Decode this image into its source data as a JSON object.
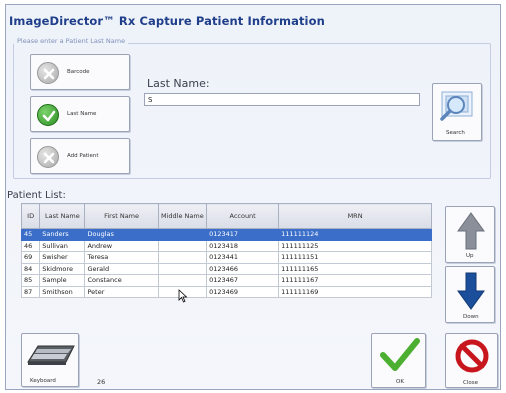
{
  "window": {
    "title": "ImageDirector™ Rx Capture Patient Information"
  },
  "search_group": {
    "legend": "Please enter a Patient Last Name",
    "buttons": {
      "barcode": "Barcode",
      "last_name": "Last Name",
      "add_patient": "Add Patient"
    },
    "last_name_label": "Last Name:",
    "last_name_value": "S",
    "search_label": "Search"
  },
  "patient_list": {
    "label": "Patient List:",
    "columns": [
      "ID",
      "Last Name",
      "First Name",
      "Middle Name",
      "Account",
      "MRN"
    ],
    "rows": [
      {
        "id": "45",
        "last": "Sanders",
        "first": "Douglas",
        "middle": "",
        "account": "0123417",
        "mrn": "111111124"
      },
      {
        "id": "46",
        "last": "Sullivan",
        "first": "Andrew",
        "middle": "",
        "account": "0123418",
        "mrn": "111111125"
      },
      {
        "id": "69",
        "last": "Swisher",
        "first": "Teresa",
        "middle": "",
        "account": "0123441",
        "mrn": "111111151"
      },
      {
        "id": "84",
        "last": "Skidmore",
        "first": "Gerald",
        "middle": "",
        "account": "0123466",
        "mrn": "111111165"
      },
      {
        "id": "85",
        "last": "Sample",
        "first": "Constance",
        "middle": "",
        "account": "0123467",
        "mrn": "111111167"
      },
      {
        "id": "87",
        "last": "Smithson",
        "first": "Peter",
        "middle": "",
        "account": "0123469",
        "mrn": "111111169"
      }
    ],
    "selected_index": 0
  },
  "side_buttons": {
    "up": "Up",
    "down": "Down"
  },
  "footer": {
    "keyboard": "Keyboard",
    "count": "26",
    "ok": "OK",
    "close": "Close"
  },
  "colors": {
    "title": "#1f3f8a",
    "selection": "#3a6ec9",
    "ok_green": "#4caf32",
    "close_red": "#c8161d",
    "arrow_blue": "#1b4f9c"
  },
  "icons": {
    "barcode": "grey-circle-x-icon",
    "last_name": "green-circle-check-icon",
    "add_patient": "grey-circle-x-icon",
    "search": "magnifier-search-icon",
    "up": "arrow-up-icon",
    "down": "arrow-down-icon",
    "keyboard": "keyboard-icon",
    "ok": "checkmark-icon",
    "close": "no-symbol-icon"
  }
}
